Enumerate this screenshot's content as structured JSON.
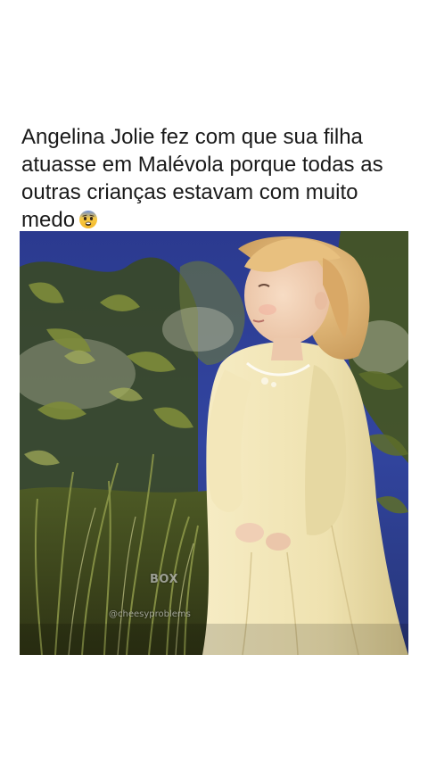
{
  "post": {
    "caption": "Angelina Jolie fez com que sua filha atuasse em Malévola porque todas as outras crianças estavam com muito medo",
    "caption_emoji": "fearful-face-emoji"
  },
  "video": {
    "watermark_logo": "BOX",
    "watermark_handle": "@cheesyproblems",
    "colors": {
      "sky": "#2d3d8a",
      "foliage": "#5a6b2e",
      "dress": "#efe3b4",
      "hair": "#e3b779"
    }
  }
}
